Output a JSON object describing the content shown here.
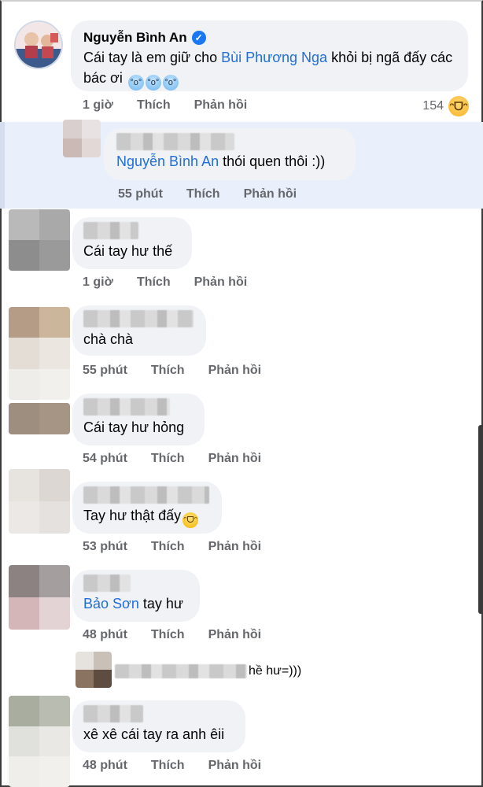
{
  "colors": {
    "mention": "#216fdb",
    "verified": "#1877f2",
    "meta": "#65676b",
    "bubble": "#f0f2f5",
    "reply_highlight": "#e9f0fb"
  },
  "actions": {
    "like": "Thích",
    "reply": "Phản hồi"
  },
  "main_comment": {
    "author": "Nguyễn Bình An",
    "verified_icon": "check-icon",
    "text_before": "Cái tay là em giữ cho ",
    "mention": "Bùi Phương Nga",
    "text_after": " khỏi bị ngã đấy các bác ơi",
    "emoji_icons": [
      "cold-sweat-face-icon",
      "cold-sweat-face-icon",
      "cold-sweat-face-icon"
    ],
    "time": "1 giờ",
    "reaction_count": "154",
    "reaction_icon": "haha-icon"
  },
  "reply": {
    "mention": "Nguyễn Bình An",
    "text": " thói quen thôi :))",
    "time": "55 phút"
  },
  "comments": [
    {
      "text": "Cái tay hư thế",
      "time": "1 giờ"
    },
    {
      "text": "chà chà",
      "time": "55 phút"
    },
    {
      "text": "Cái tay hư hỏng",
      "time": "54 phút"
    },
    {
      "text": "Tay hư thật đấy",
      "emoji_icon": "laughing-face-icon",
      "time": "53 phút"
    },
    {
      "mention": "Bảo Sơn",
      "text": " tay hư",
      "time": "48 phút"
    },
    {
      "partial": "hề hư=)))"
    },
    {
      "text": "xê xê cái tay ra anh êii",
      "time": "48 phút"
    }
  ]
}
